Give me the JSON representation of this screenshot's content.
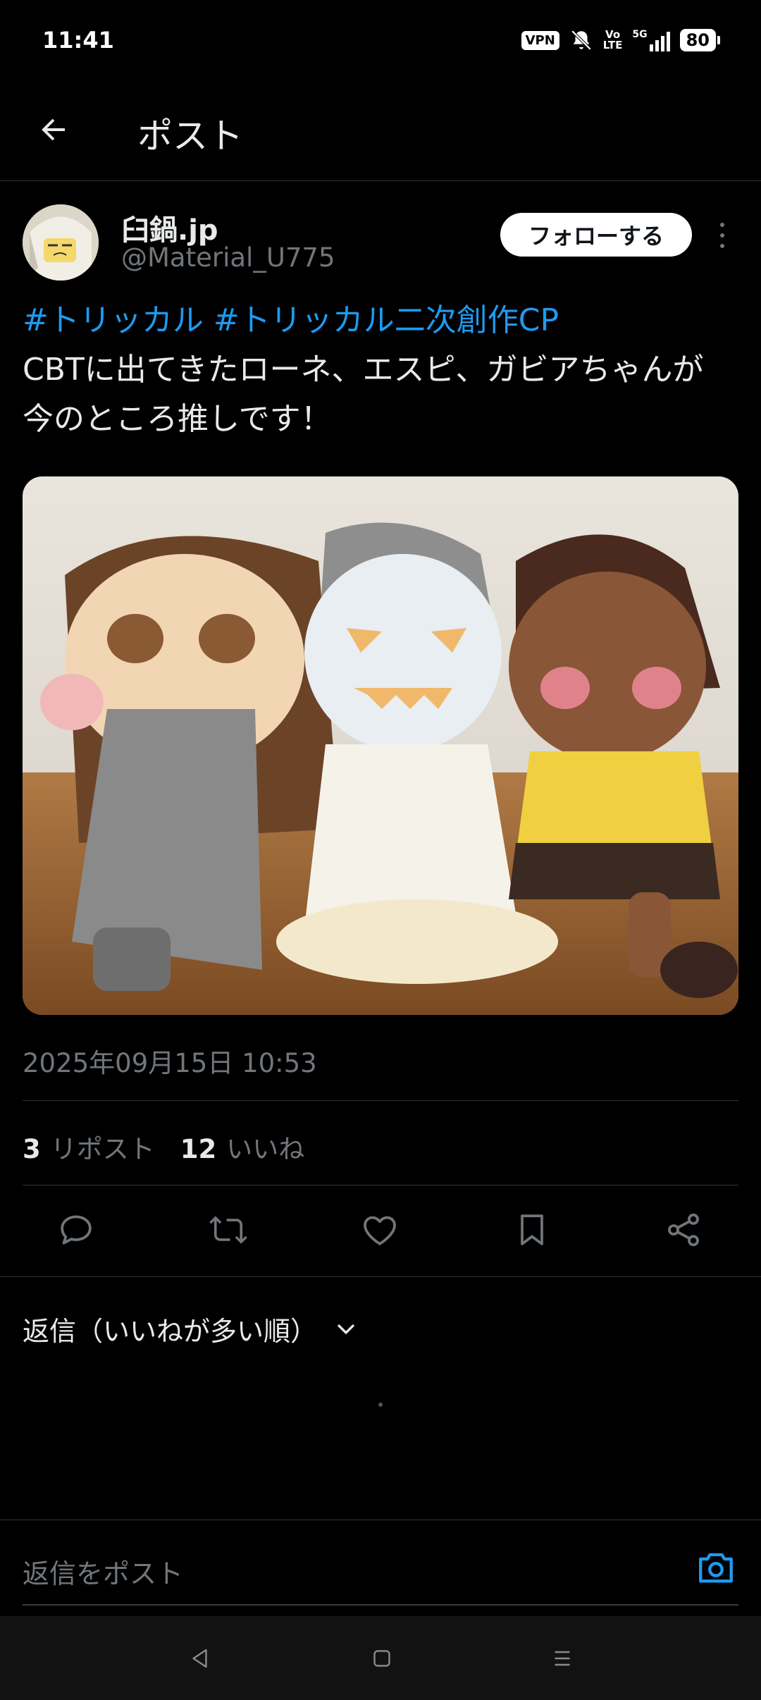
{
  "status_bar": {
    "time": "11:41",
    "vpn": "VPN",
    "volte": "Vo\nLTE",
    "network": "5G",
    "battery": "80"
  },
  "header": {
    "title": "ポスト"
  },
  "post": {
    "author_name": "臼鍋.jp",
    "author_handle": "@Material_U775",
    "follow_label": "フォローする",
    "hashtags": [
      "#トリッカル",
      "#トリッカル二次創作CP"
    ],
    "body_line1": "CBTに出てきたローネ、エスピ、ガビアちゃんが",
    "body_line2": "今のところ推しです！",
    "timestamp": "2025年09月15日 10:53",
    "reposts_count": "3",
    "reposts_label": "リポスト",
    "likes_count": "12",
    "likes_label": "いいね"
  },
  "replies": {
    "sort_label": "返信（いいねが多い順）"
  },
  "composer": {
    "placeholder": "返信をポスト"
  },
  "colors": {
    "accent": "#1d9bf0",
    "muted": "#71767b",
    "divider": "#2f3336"
  },
  "icons": [
    "back-arrow-icon",
    "kebab-icon",
    "reply-icon",
    "repost-icon",
    "like-icon",
    "bookmark-icon",
    "share-icon",
    "chevron-down-icon",
    "camera-icon",
    "nav-back-icon",
    "nav-home-icon",
    "nav-menu-icon"
  ]
}
